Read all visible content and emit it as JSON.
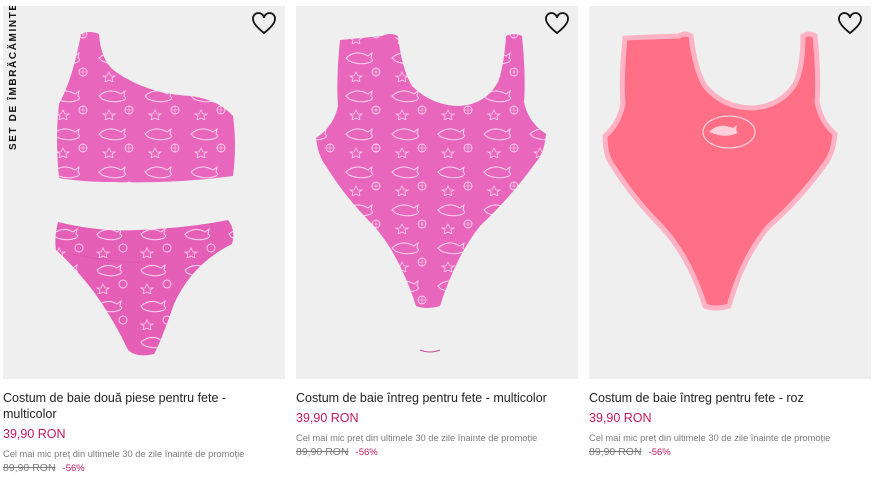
{
  "products": [
    {
      "badge": "SET DE ÎMBRĂCĂMINTE",
      "title": "Costum de baie două piese pentru fete - multicolor",
      "price": "39,90 RON",
      "lowest_price_note": "Cel mai mic preț din ultimele 30 de zile înainte de promoție",
      "old_price": "89,90 RON",
      "discount": "-56%",
      "favorite_icon": "heart-outline-icon"
    },
    {
      "title": "Costum de baie întreg pentru fete - multicolor",
      "price": "39,90 RON",
      "lowest_price_note": "Cel mai mic preț din ultimele 30 de zile înainte de promoție",
      "old_price": "89,90 RON",
      "discount": "-56%",
      "favorite_icon": "heart-outline-icon"
    },
    {
      "title": "Costum de baie întreg pentru fete - roz",
      "price": "39,90 RON",
      "lowest_price_note": "Cel mai mic preț din ultimele 30 de zile înainte de promoție",
      "old_price": "89,90 RON",
      "discount": "-56%",
      "favorite_icon": "heart-outline-icon"
    }
  ],
  "colors": {
    "price_accent": "#c0195e",
    "card_background": "#efefef",
    "swim_pink": "#e65fb6",
    "swim_coral": "#ff6f86"
  }
}
